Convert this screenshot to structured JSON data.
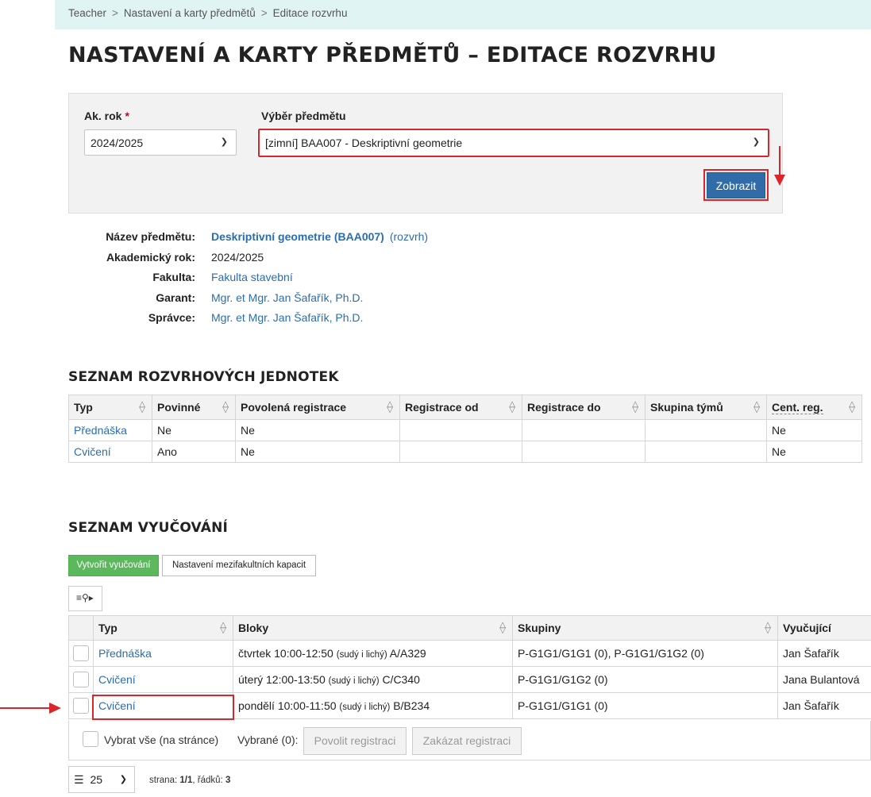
{
  "breadcrumb": [
    "Teacher",
    "Nastavení a karty předmětů",
    "Editace rozvrhu"
  ],
  "page_title": "NASTAVENÍ A KARTY PŘEDMĚTŮ – EDITACE ROZVRHU",
  "filter": {
    "year_label": "Ak. rok",
    "required_mark": "*",
    "year_value": "2024/2025",
    "subject_label": "Výběr předmětu",
    "subject_value": "[zimní] BAA007 -  Deskriptivní geometrie",
    "show_button": "Zobrazit"
  },
  "subject_info": {
    "name_label": "Název předmětu:",
    "name_value": "Deskriptivní geometrie (BAA007)",
    "schedule_link": "(rozvrh)",
    "year_label": "Akademický rok:",
    "year_value": "2024/2025",
    "faculty_label": "Fakulta:",
    "faculty_value": "Fakulta stavební",
    "guarantor_label": "Garant:",
    "guarantor_value": "Mgr. et Mgr. Jan Šafařík, Ph.D.",
    "admin_label": "Správce:",
    "admin_value": "Mgr. et Mgr. Jan Šafařík, Ph.D."
  },
  "units": {
    "title": "SEZNAM ROZVRHOVÝCH JEDNOTEK",
    "headers": [
      "Typ",
      "Povinné",
      "Povolená registrace",
      "Registrace od",
      "Registrace do",
      "Skupina týmů",
      "Cent. reg."
    ],
    "rows": [
      [
        "Přednáška",
        "Ne",
        "Ne",
        "",
        "",
        "",
        "Ne"
      ],
      [
        "Cvičení",
        "Ano",
        "Ne",
        "",
        "",
        "",
        "Ne"
      ]
    ]
  },
  "lessons": {
    "title": "SEZNAM VYUČOVÁNÍ",
    "create_button": "Vytvořit vyučování",
    "capacity_button": "Nastavení mezifakultních kapacit",
    "headers": [
      "Typ",
      "Bloky",
      "Skupiny",
      "Vyučující"
    ],
    "rows": [
      {
        "type": "Přednáška",
        "block": "čtvrtek 10:00-12:50",
        "parity": "(sudý i lichý)",
        "room": "A/A329",
        "groups": "P-G1G1/G1G1 (0), P-G1G1/G1G2 (0)",
        "teacher": "Jan Šafařík"
      },
      {
        "type": "Cvičení",
        "block": "úterý 12:00-13:50",
        "parity": "(sudý i lichý)",
        "room": "C/C340",
        "groups": "P-G1G1/G1G2 (0)",
        "teacher": "Jana Bulantová"
      },
      {
        "type": "Cvičení",
        "block": "pondělí 10:00-11:50",
        "parity": "(sudý i lichý)",
        "room": "B/B234",
        "groups": "P-G1G1/G1G1 (0)",
        "teacher": "Jan Šafařík"
      }
    ],
    "select_all": "Vybrat vše (na stránce)",
    "selected": "Vybrané (0):",
    "allow_button": "Povolit registraci",
    "deny_button": "Zakázat registraci",
    "page_size": "25",
    "page_label": "strana:",
    "page_value": "1/1",
    "rows_label": "řádků:",
    "rows_value": "3"
  },
  "colors": {
    "accent": "#2f6ca8",
    "green": "#5cb85c",
    "highlight": "#d9262c",
    "breadcrumb_bg": "#e0f4f4"
  },
  "icons": [
    "chevron-down-icon",
    "sort-icon",
    "filter-icon",
    "list-icon",
    "arrow-down-icon",
    "arrow-right-icon"
  ]
}
